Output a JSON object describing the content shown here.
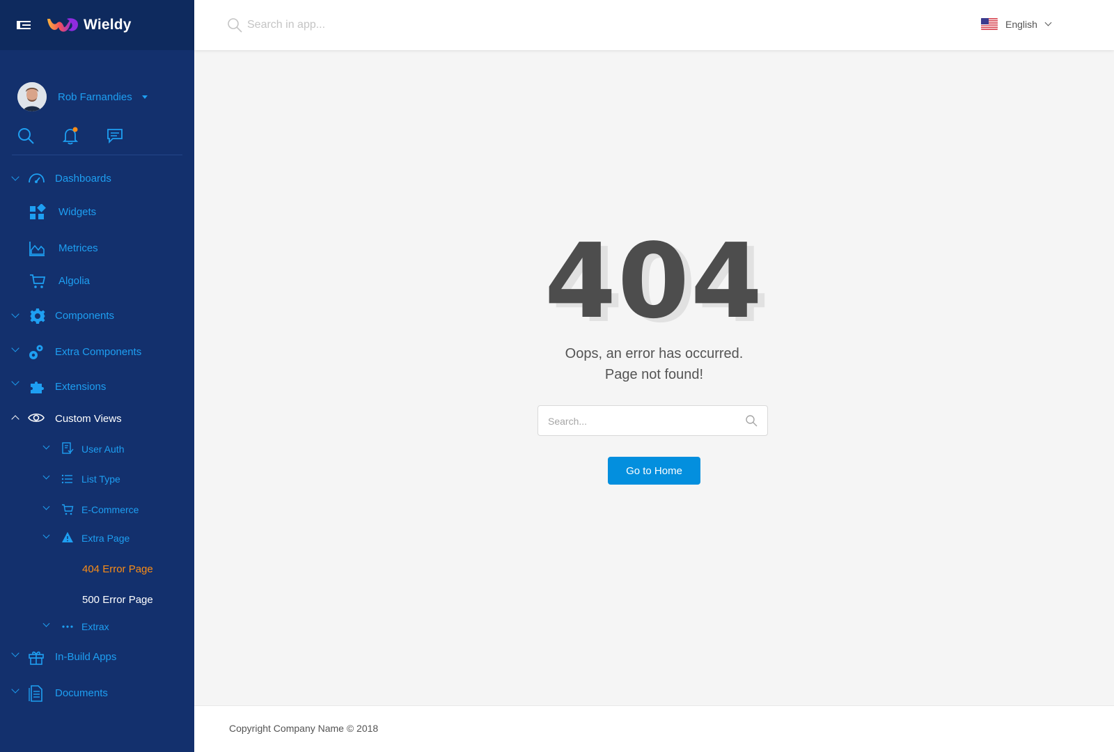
{
  "app": {
    "brand": "Wieldy"
  },
  "user": {
    "name": "Rob Farnandies"
  },
  "topbar": {
    "search_placeholder": "Search in app...",
    "language": "English"
  },
  "sidebar": {
    "items": [
      {
        "label": "Dashboards",
        "icon": "dashboard-icon"
      },
      {
        "label": "Widgets",
        "icon": "widgets-icon"
      },
      {
        "label": "Metrices",
        "icon": "area-chart-icon"
      },
      {
        "label": "Algolia",
        "icon": "cart-icon"
      },
      {
        "label": "Components",
        "icon": "gear-icon"
      },
      {
        "label": "Extra Components",
        "icon": "gears-icon"
      },
      {
        "label": "Extensions",
        "icon": "puzzle-icon"
      },
      {
        "label": "Custom Views",
        "icon": "eye-icon"
      },
      {
        "label": "User Auth",
        "icon": "auth-icon"
      },
      {
        "label": "List Type",
        "icon": "list-icon"
      },
      {
        "label": "E-Commerce",
        "icon": "cart-icon"
      },
      {
        "label": "Extra Page",
        "icon": "warning-icon"
      },
      {
        "label": "404 Error Page"
      },
      {
        "label": "500 Error Page"
      },
      {
        "label": "Extrax",
        "icon": "dots-icon"
      },
      {
        "label": "In-Build Apps",
        "icon": "gift-icon"
      },
      {
        "label": "Documents",
        "icon": "document-icon"
      }
    ]
  },
  "error": {
    "code": "404",
    "line1": "Oops, an error has occurred.",
    "line2": "Page not found!",
    "search_placeholder": "Search...",
    "button": "Go to Home"
  },
  "footer": {
    "copyright": "Copyright Company Name © 2018"
  },
  "colors": {
    "sidebar_bg": "#13306d",
    "sidebar_header_bg": "#0e2a5e",
    "accent": "#038fde",
    "link": "#1e9ff2",
    "active": "#fa8c16"
  }
}
